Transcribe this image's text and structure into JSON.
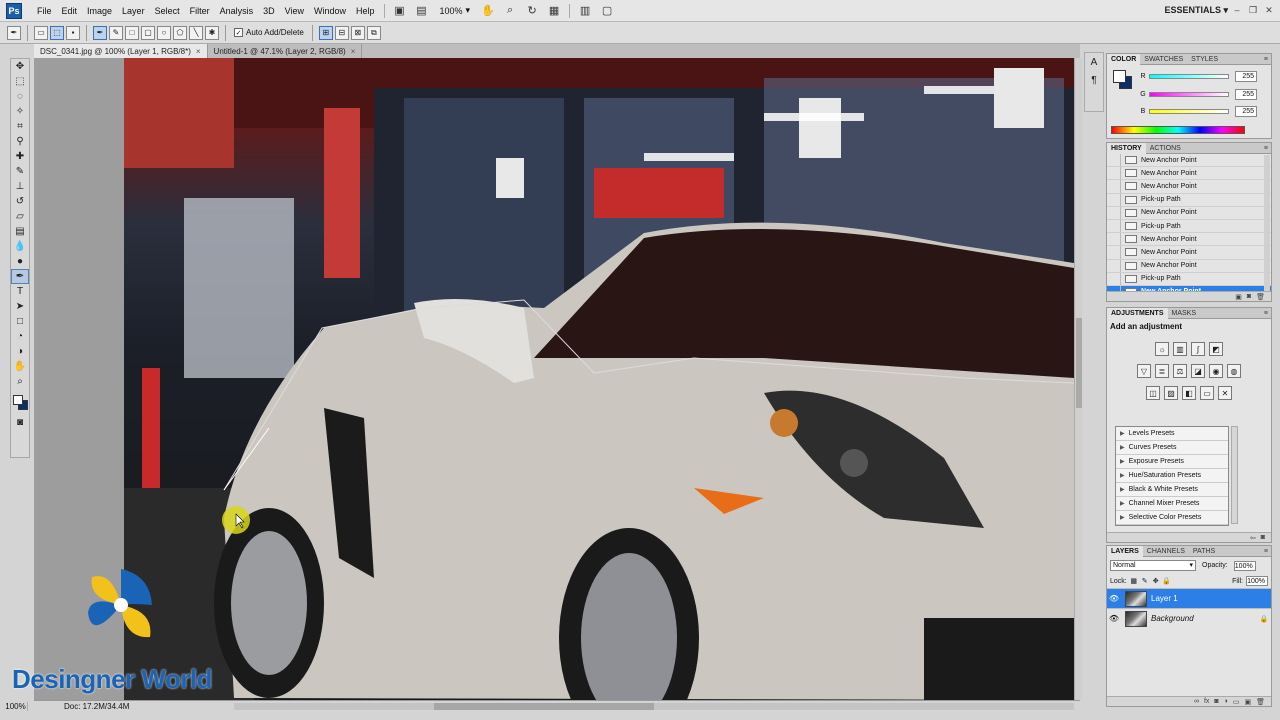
{
  "app": {
    "logo": "Ps",
    "workspace": "ESSENTIALS",
    "zoom_menu": "100%"
  },
  "menu": [
    "File",
    "Edit",
    "Image",
    "Layer",
    "Select",
    "Filter",
    "Analysis",
    "3D",
    "View",
    "Window",
    "Help"
  ],
  "options_bar": {
    "auto_add_label": "Auto Add/Delete",
    "auto_add_checked": "✓"
  },
  "tabs": [
    {
      "label": "DSC_0341.jpg @ 100% (Layer 1, RGB/8*)",
      "close": "×"
    },
    {
      "label": "Untitled-1 @ 47.1% (Layer 2, RGB/8)",
      "close": "×"
    }
  ],
  "status": {
    "zoom": "100%",
    "doc": "Doc: 17.2M/34.4M"
  },
  "watermark": {
    "text": "Desingner World"
  },
  "color_panel": {
    "tabs": [
      "COLOR",
      "SWATCHES",
      "STYLES"
    ],
    "sliders": [
      {
        "label": "R",
        "value": "255"
      },
      {
        "label": "G",
        "value": "255"
      },
      {
        "label": "B",
        "value": "255"
      }
    ]
  },
  "history_panel": {
    "tabs": [
      "HISTORY",
      "ACTIONS"
    ],
    "items": [
      "New Anchor Point",
      "New Anchor Point",
      "New Anchor Point",
      "Pick-up Path",
      "New Anchor Point",
      "Pick-up Path",
      "New Anchor Point",
      "New Anchor Point",
      "New Anchor Point",
      "Pick-up Path",
      "New Anchor Point"
    ]
  },
  "adjustments_panel": {
    "tabs": [
      "ADJUSTMENTS",
      "MASKS"
    ],
    "title": "Add an adjustment",
    "presets": [
      "Levels Presets",
      "Curves Presets",
      "Exposure Presets",
      "Hue/Saturation Presets",
      "Black & White Presets",
      "Channel Mixer Presets",
      "Selective Color Presets"
    ]
  },
  "layers_panel": {
    "tabs": [
      "LAYERS",
      "CHANNELS",
      "PATHS"
    ],
    "blend_mode": "Normal",
    "opacity_label": "Opacity:",
    "opacity": "100%",
    "lock_label": "Lock:",
    "fill_label": "Fill:",
    "fill": "100%",
    "layers": [
      {
        "name": "Layer 1"
      },
      {
        "name": "Background"
      }
    ]
  }
}
